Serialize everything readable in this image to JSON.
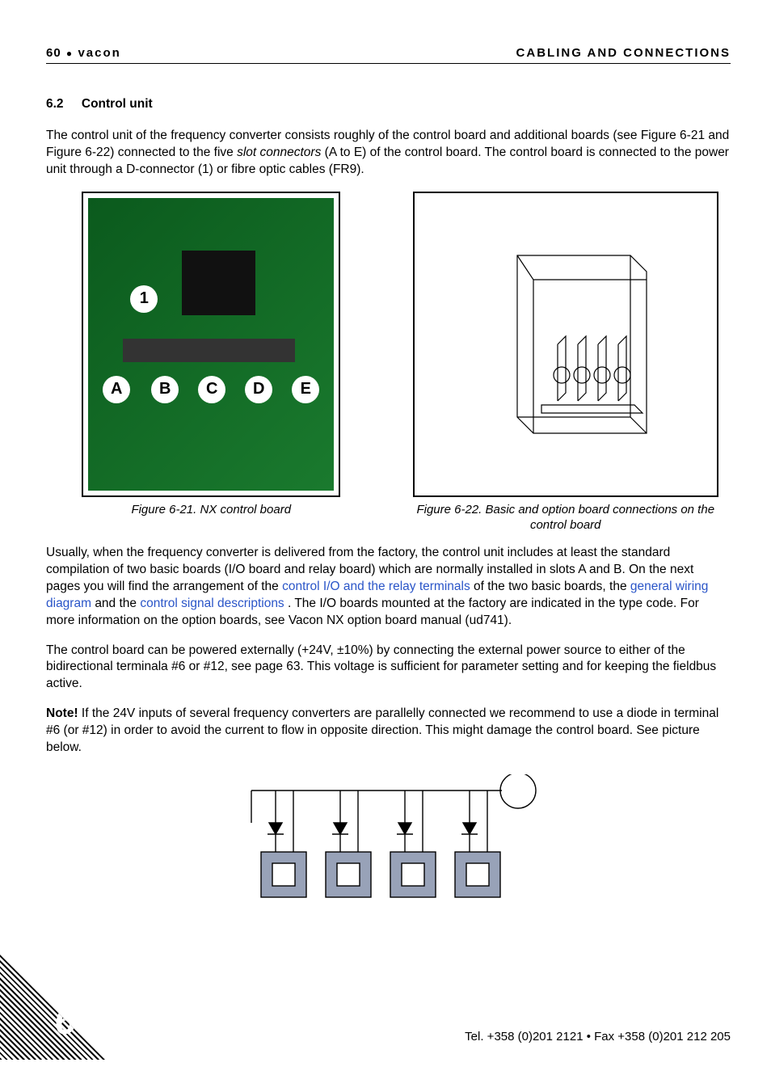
{
  "header": {
    "page_number": "60",
    "brand": "vacon",
    "right": "CABLING AND CONNECTIONS"
  },
  "section": {
    "number": "6.2",
    "title": "Control unit"
  },
  "intro": {
    "part1": "The control unit of the frequency converter consists roughly of the control board and additional boards (see Figure 6-21 and Figure 6-22) connected to the five ",
    "slot_conn": "slot connectors",
    "part2": " (A to E) of the control board. The control board is connected to the power unit through a D-connector (1) or fibre optic cables (FR9)."
  },
  "figures": {
    "left_caption": "Figure 6-21. NX control board",
    "right_caption": "Figure 6-22. Basic and option board connections on the control board",
    "pcb_labels": [
      "1",
      "A",
      "B",
      "C",
      "D",
      "E"
    ]
  },
  "para2": {
    "a": "Usually, when the frequency converter is delivered from the factory, the control unit includes at least the standard compilation of two basic boards (I/O board and relay board) which are normally installed in slots A and B. On the next pages you will find the arrangement of the ",
    "link1": "control I/O and the relay terminals",
    "b": " of the two basic boards, the ",
    "link2": "general wiring diagram",
    "c": " and the ",
    "link3": "control signal descriptions",
    "d": ". The I/O boards mounted at the factory are indicated in the type code. For more information on the option boards, see Vacon NX option board manual (ud741)."
  },
  "para3": "The control board can be powered externally (+24V, ±10%) by connecting the external power source to either of the bidirectional terminala #6 or #12, see page 63. This voltage is sufficient for parameter setting and for keeping the fieldbus active.",
  "note": {
    "label": "Note!",
    "text": " If the 24V inputs of several frequency converters are parallelly connected we recommend to use a diode in terminal #6 (or #12) in order to avoid the current to flow in opposite direction. This might damage the control board. See picture below."
  },
  "footer": {
    "contact": "Tel. +358 (0)201 2121 • Fax +358 (0)201 212 205",
    "chapter": "6"
  }
}
